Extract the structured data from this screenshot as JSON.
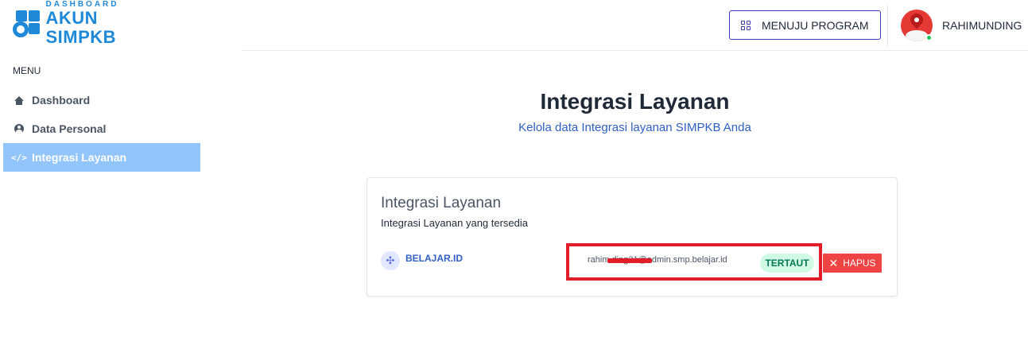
{
  "logo": {
    "small": "DASHBOARD",
    "big": "AKUN SIMPKB",
    "color": "#1e88d9"
  },
  "header": {
    "program_button": "MENUJU PROGRAM",
    "program_icon": "grid-icon",
    "username": "RAHIMUNDING",
    "online": true
  },
  "sidebar": {
    "menu_label": "MENU",
    "items": [
      {
        "label": "Dashboard",
        "icon": "home-icon",
        "active": false
      },
      {
        "label": "Data Personal",
        "icon": "user-circle-icon",
        "active": false
      },
      {
        "label": "Integrasi Layanan",
        "icon": "code-icon",
        "active": true
      }
    ]
  },
  "main": {
    "title": "Integrasi Layanan",
    "subtitle": "Kelola data Integrasi layanan SIMPKB Anda",
    "card": {
      "title": "Integrasi Layanan",
      "subtitle": "Integrasi Layanan yang tersedia",
      "service": {
        "name": "BELAJAR.ID",
        "icon": "puzzle-icon",
        "email": "rahim      ding31@admin.smp.belajar.id",
        "status": "TERTAUT",
        "delete_label": "HAPUS"
      }
    }
  },
  "colors": {
    "accent": "#93c5fd",
    "link": "#2f5fc4",
    "danger": "#ef4444",
    "success_bg": "#d1fae5",
    "success_text": "#047857"
  }
}
